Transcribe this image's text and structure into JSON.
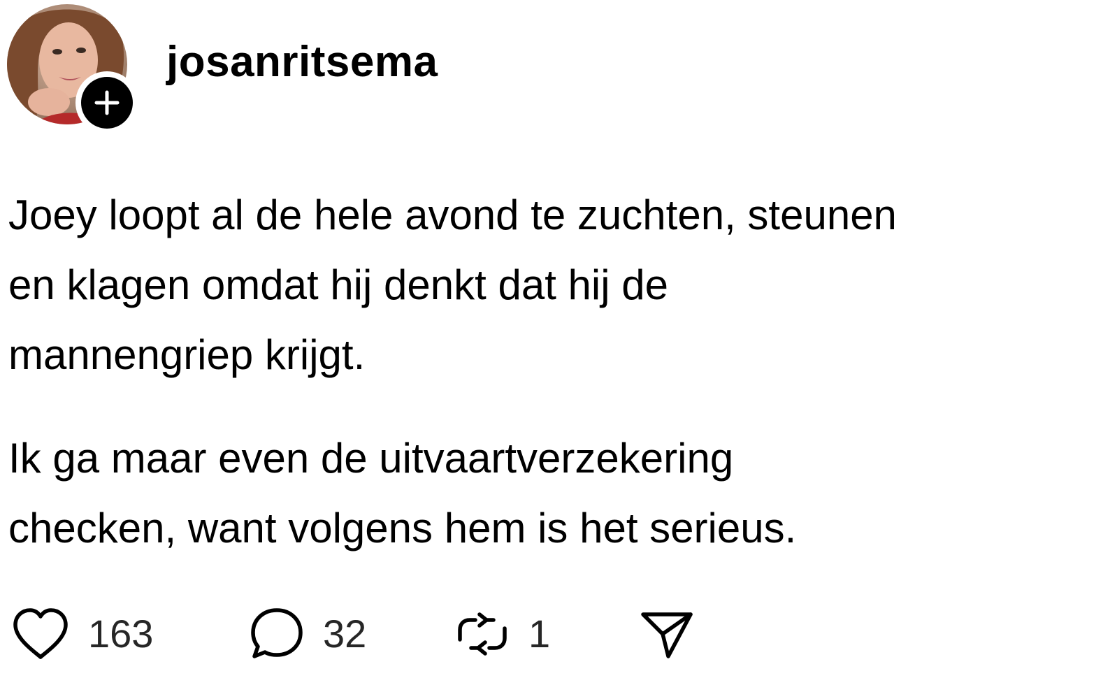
{
  "post": {
    "author": {
      "username": "josanritsema",
      "avatar_icon": "profile-photo",
      "follow_icon": "plus-icon"
    },
    "paragraphs": [
      {
        "lines": [
          "Joey loopt al de hele avond te zuchten, steunen",
          "en klagen omdat hij denkt dat hij de",
          "mannengriep krijgt."
        ]
      },
      {
        "lines": [
          "Ik ga maar even de uitvaartverzekering",
          "checken, want volgens hem is het serieus."
        ]
      }
    ],
    "actions": {
      "like": {
        "icon": "heart-icon",
        "count": "163"
      },
      "reply": {
        "icon": "comment-icon",
        "count": "32"
      },
      "repost": {
        "icon": "repost-icon",
        "count": "1"
      },
      "share": {
        "icon": "send-icon"
      }
    }
  },
  "colors": {
    "background": "#ffffff",
    "text": "#000000",
    "count_text": "#262626",
    "badge": "#000000"
  }
}
